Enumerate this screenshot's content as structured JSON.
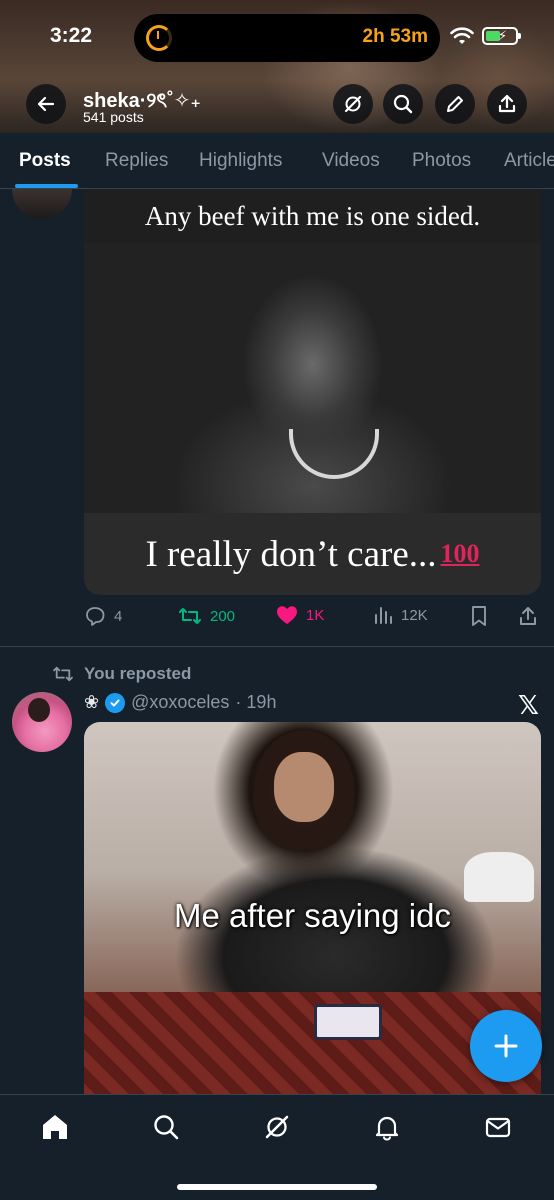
{
  "status_bar": {
    "time": "3:22",
    "timer": "2h 53m"
  },
  "profile": {
    "name": "sheka·୨ৎ˚✧₊",
    "post_count": "541 posts"
  },
  "tabs": [
    {
      "label": "Posts"
    },
    {
      "label": "Replies"
    },
    {
      "label": "Highlights"
    },
    {
      "label": "Videos"
    },
    {
      "label": "Photos"
    },
    {
      "label": "Articles"
    }
  ],
  "post1": {
    "image_caption_top": "Any beef with me is one sided.",
    "image_caption_bottom": "I really don’t care...",
    "image_emoji": "100",
    "replies": "4",
    "reposts": "200",
    "likes": "1K",
    "views": "12K"
  },
  "post2": {
    "repost_label": "You reposted",
    "author_prefix": "❀",
    "handle": "@xoxoceles",
    "time": "· 19h",
    "meme_text": "Me after saying idc"
  },
  "icons": {
    "back": "arrow-left-icon",
    "grok": "grok-icon",
    "search": "search-icon",
    "edit": "pencil-icon",
    "share": "share-icon",
    "x": "x-logo-icon"
  },
  "colors": {
    "accent": "#1d9bf0",
    "repost": "#00ba7c",
    "like": "#f91880",
    "background": "#15202b"
  }
}
